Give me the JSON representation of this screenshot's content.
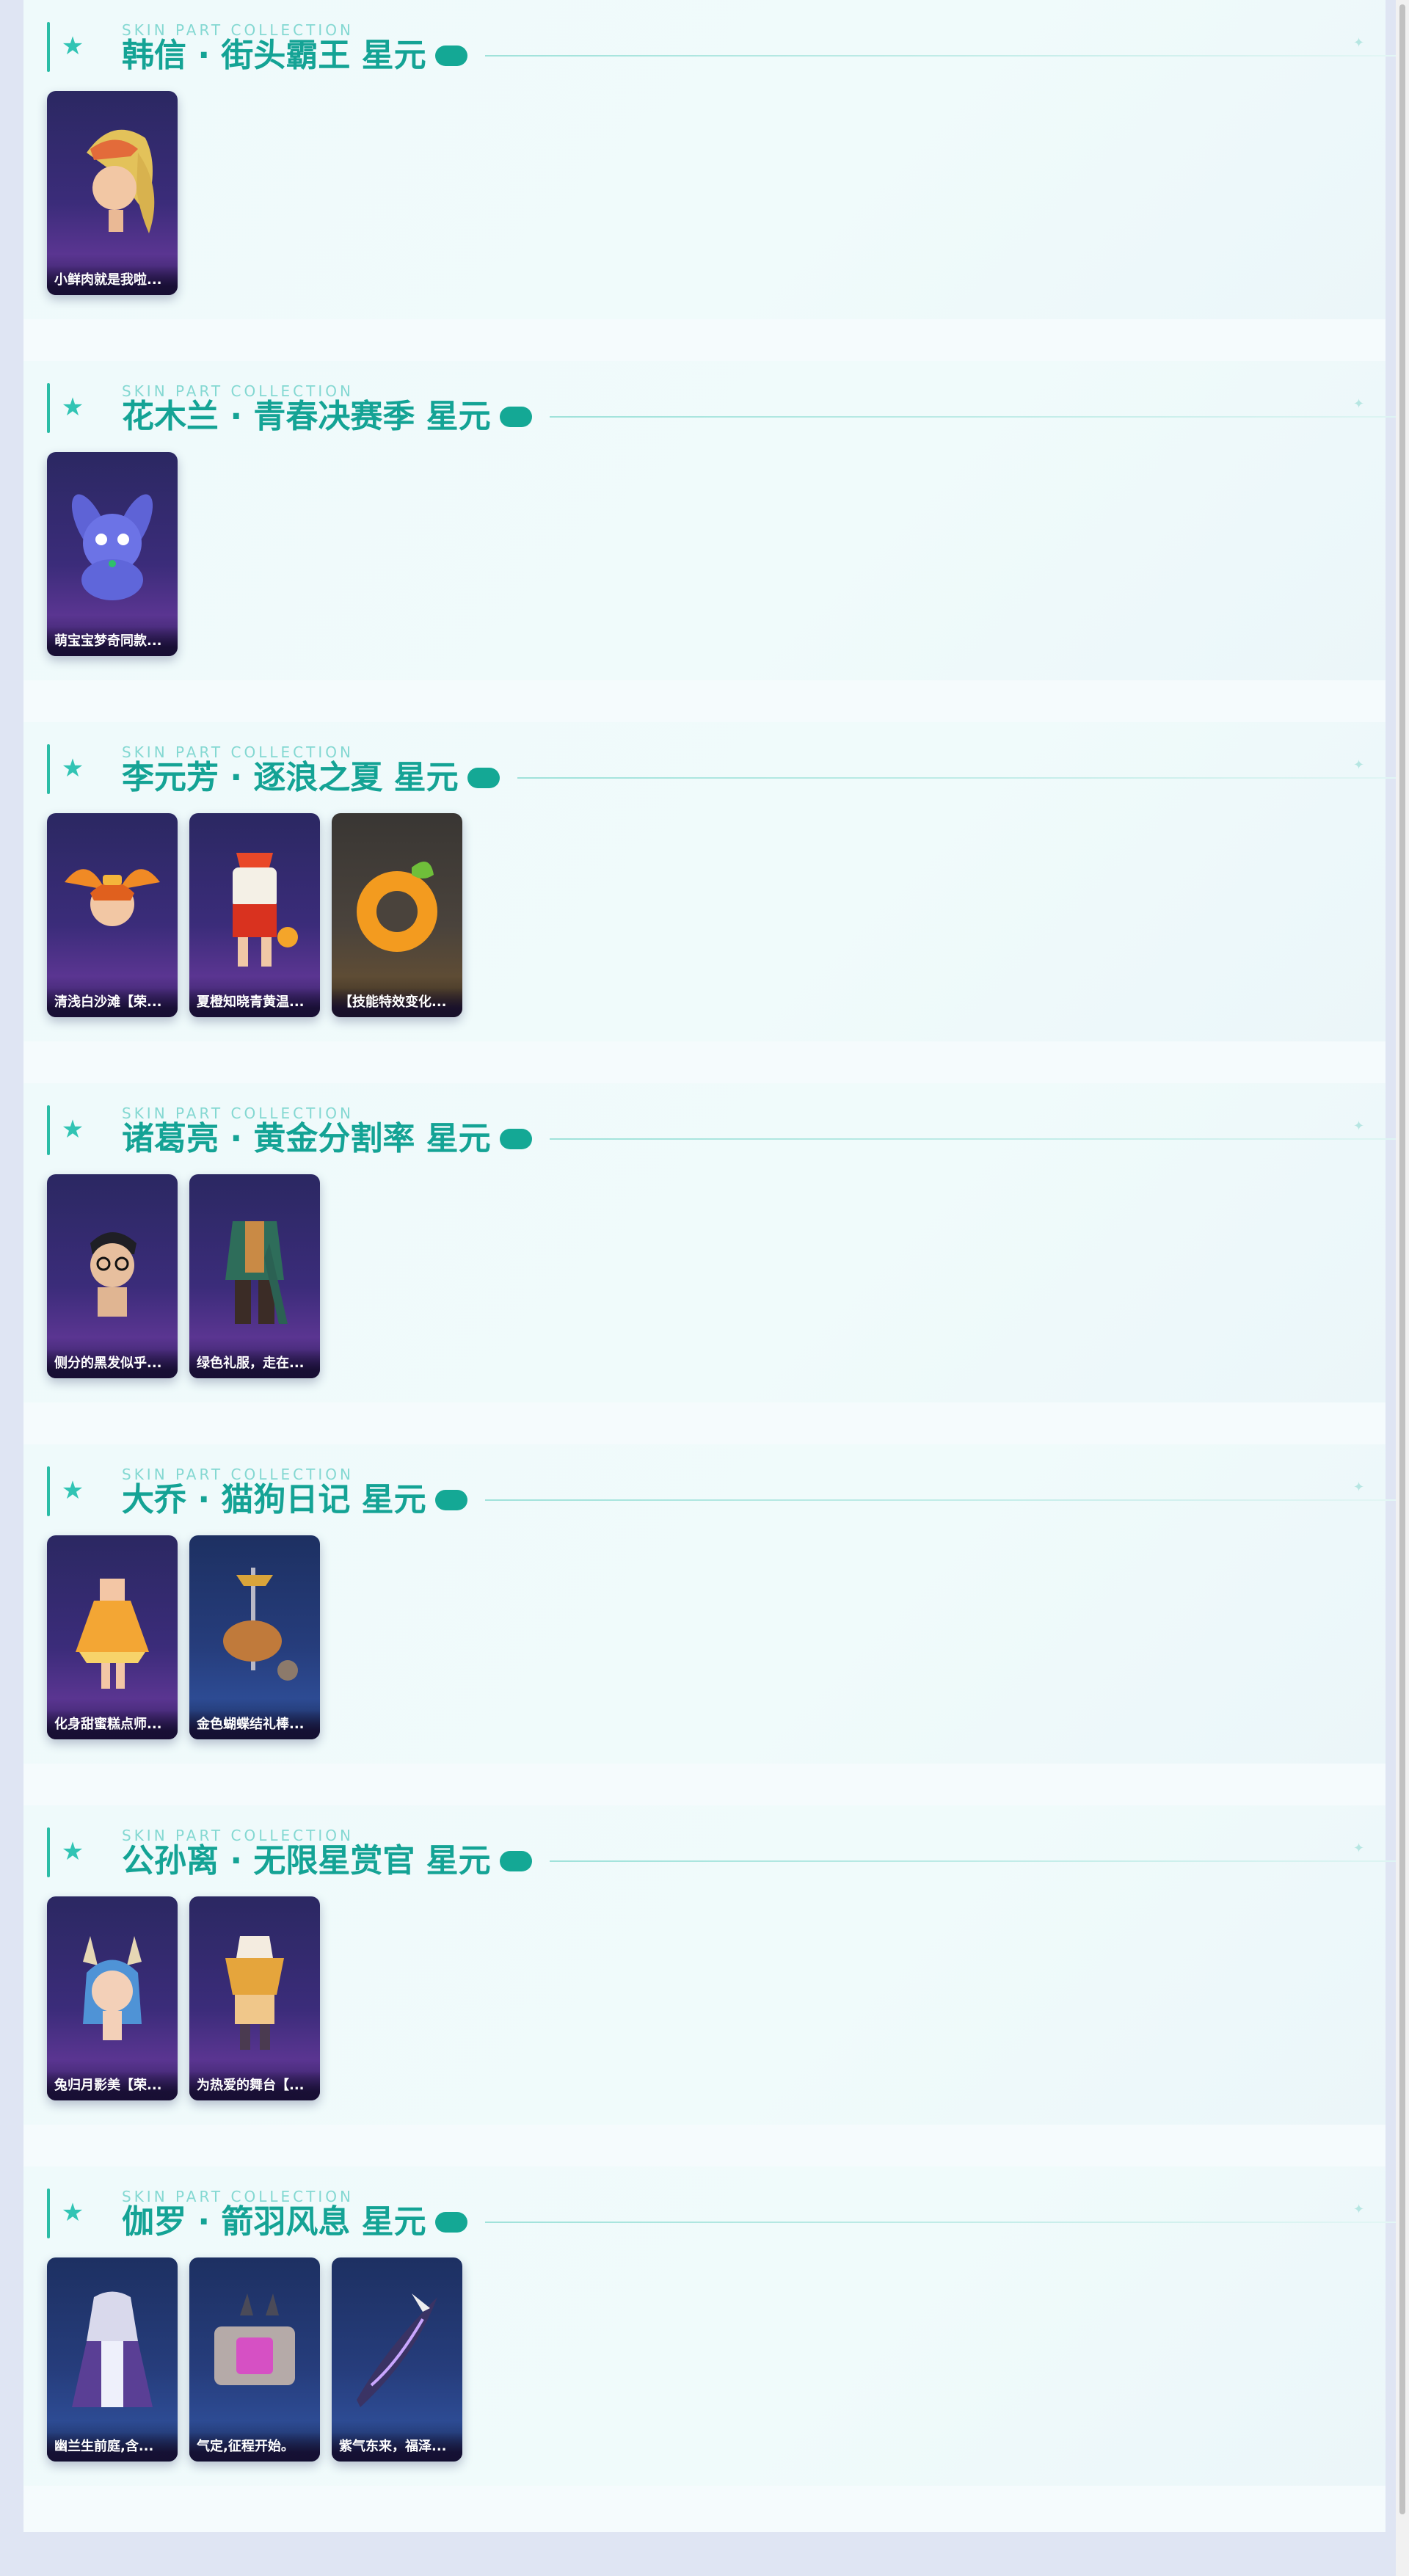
{
  "sections": [
    {
      "caption": "SKIN PART COLLECTION",
      "title": "韩信 · 街头霸王 星元",
      "items": [
        {
          "label": "小鲜肉就是我啦...",
          "icon": "blonde-hair-head-icon",
          "tone": "purple"
        }
      ]
    },
    {
      "caption": "SKIN PART COLLECTION",
      "title": "花木兰 · 青春决赛季 星元",
      "items": [
        {
          "label": "萌宝宝梦奇同款...",
          "icon": "blue-bunny-plush-icon",
          "tone": "purple"
        }
      ]
    },
    {
      "caption": "SKIN PART COLLECTION",
      "title": "李元芳 · 逐浪之夏 星元",
      "items": [
        {
          "label": "清浅白沙滩【荣...",
          "icon": "orange-winged-head-icon",
          "tone": "purple"
        },
        {
          "label": "夏橙知晓青黄温...",
          "icon": "summer-outfit-icon",
          "tone": "purple"
        },
        {
          "label": "【技能特效变化...",
          "icon": "orange-ring-effect-icon",
          "tone": "bronze"
        }
      ]
    },
    {
      "caption": "SKIN PART COLLECTION",
      "title": "诸葛亮 · 黄金分割率 星元",
      "items": [
        {
          "label": "侧分的黑发似乎...",
          "icon": "glasses-head-icon",
          "tone": "purple"
        },
        {
          "label": "绿色礼服，走在...",
          "icon": "green-suit-icon",
          "tone": "purple"
        }
      ]
    },
    {
      "caption": "SKIN PART COLLECTION",
      "title": "大乔 · 猫狗日记 星元",
      "items": [
        {
          "label": "化身甜蜜糕点师...",
          "icon": "orange-dress-icon",
          "tone": "purple"
        },
        {
          "label": "金色蝴蝶结礼棒...",
          "icon": "pet-scepter-icon",
          "tone": "blue"
        }
      ]
    },
    {
      "caption": "SKIN PART COLLECTION",
      "title": "公孙离 · 无限星赏官 星元",
      "items": [
        {
          "label": "兔归月影美【荣...",
          "icon": "blue-hair-bunny-head-icon",
          "tone": "purple"
        },
        {
          "label": "为热爱的舞台【...",
          "icon": "stage-outfit-icon",
          "tone": "purple"
        }
      ]
    },
    {
      "caption": "SKIN PART COLLECTION",
      "title": "伽罗 · 箭羽风息 星元",
      "items": [
        {
          "label": "幽兰生前庭,含...",
          "icon": "white-purple-outfit-icon",
          "tone": "blue"
        },
        {
          "label": "气定,征程开始。",
          "icon": "quiver-bag-icon",
          "tone": "blue"
        },
        {
          "label": "紫气东来，福泽...",
          "icon": "purple-bow-icon",
          "tone": "blue"
        }
      ]
    }
  ]
}
